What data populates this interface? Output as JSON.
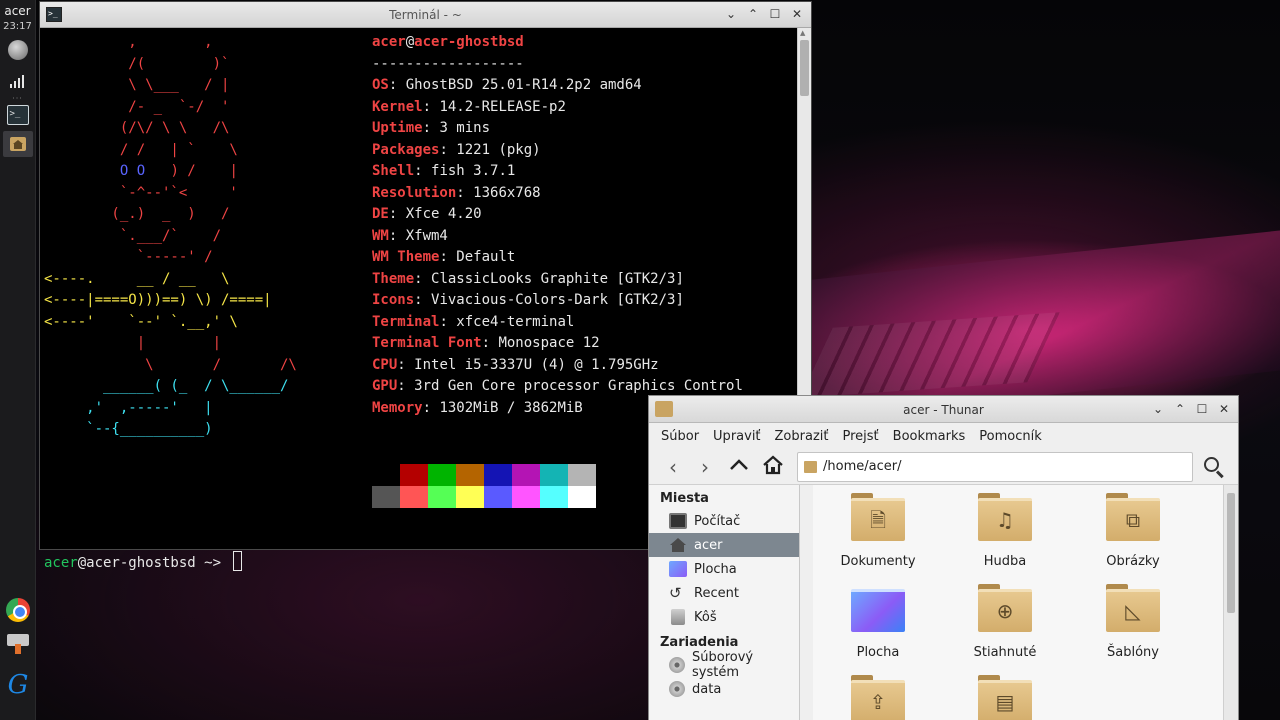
{
  "panel": {
    "user": "acer",
    "clock": "23:17"
  },
  "terminal": {
    "title": "Terminál - ~",
    "header_user": "acer",
    "header_host": "acer-ghostbsd",
    "separator": "------------------",
    "info": [
      {
        "key": "OS",
        "value": "GhostBSD 25.01-R14.2p2 amd64"
      },
      {
        "key": "Kernel",
        "value": "14.2-RELEASE-p2"
      },
      {
        "key": "Uptime",
        "value": "3 mins"
      },
      {
        "key": "Packages",
        "value": "1221 (pkg)"
      },
      {
        "key": "Shell",
        "value": "fish 3.7.1"
      },
      {
        "key": "Resolution",
        "value": "1366x768"
      },
      {
        "key": "DE",
        "value": "Xfce 4.20"
      },
      {
        "key": "WM",
        "value": "Xfwm4"
      },
      {
        "key": "WM Theme",
        "value": "Default"
      },
      {
        "key": "Theme",
        "value": "ClassicLooks Graphite [GTK2/3]"
      },
      {
        "key": "Icons",
        "value": "Vivacious-Colors-Dark [GTK2/3]"
      },
      {
        "key": "Terminal",
        "value": "xfce4-terminal"
      },
      {
        "key": "Terminal Font",
        "value": "Monospace 12"
      },
      {
        "key": "CPU",
        "value": "Intel i5-3337U (4) @ 1.795GHz"
      },
      {
        "key": "GPU",
        "value": "3rd Gen Core processor Graphics Control"
      },
      {
        "key": "Memory",
        "value": "1302MiB / 3862MiB"
      }
    ],
    "palette_top": [
      "#000000",
      "#b40000",
      "#00b400",
      "#b46400",
      "#1414b4",
      "#b414b4",
      "#14b4b4",
      "#b4b4b4"
    ],
    "palette_bottom": [
      "#555555",
      "#ff5555",
      "#55ff55",
      "#ffff55",
      "#5a5aff",
      "#ff55ff",
      "#55ffff",
      "#ffffff"
    ],
    "prompt_user": "acer",
    "prompt_host": "@acer-ghostbsd",
    "prompt_path": " ~> "
  },
  "thunar": {
    "title": "acer - Thunar",
    "menu": [
      "Súbor",
      "Upraviť",
      "Zobraziť",
      "Prejsť",
      "Bookmarks",
      "Pomocník"
    ],
    "location": "/home/acer/",
    "sections": {
      "places": "Miesta",
      "devices": "Zariadenia"
    },
    "places": [
      "Počítač",
      "acer",
      "Plocha",
      "Recent",
      "Kôš"
    ],
    "devices": [
      "Súborový systém",
      "data"
    ],
    "folders": [
      "Dokumenty",
      "Hudba",
      "Obrázky",
      "Plocha",
      "Stiahnuté",
      "Šablóny"
    ]
  }
}
